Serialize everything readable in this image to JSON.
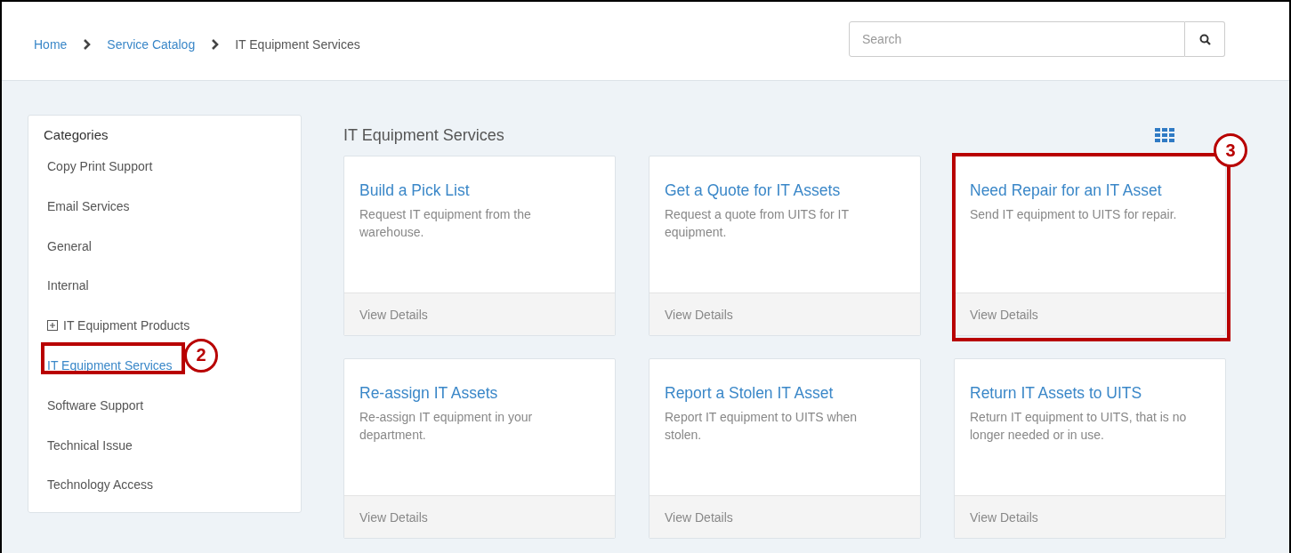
{
  "breadcrumb": [
    {
      "label": "Home",
      "link": true
    },
    {
      "label": "Service Catalog",
      "link": true
    },
    {
      "label": "IT Equipment Services",
      "link": false
    }
  ],
  "search": {
    "placeholder": "Search"
  },
  "sidebar": {
    "title": "Categories",
    "items": [
      {
        "label": "Copy Print Support",
        "selected": false
      },
      {
        "label": "Email Services",
        "selected": false
      },
      {
        "label": "General",
        "selected": false
      },
      {
        "label": "Internal",
        "selected": false
      },
      {
        "label": "IT Equipment Products",
        "selected": false,
        "expandable": true
      },
      {
        "label": "IT Equipment Services",
        "selected": true,
        "callout": "2"
      },
      {
        "label": "Software Support",
        "selected": false
      },
      {
        "label": "Technical Issue",
        "selected": false
      },
      {
        "label": "Technology Access",
        "selected": false
      }
    ]
  },
  "content": {
    "title": "IT Equipment Services",
    "cards": [
      {
        "title": "Build a Pick List",
        "description": "Request IT equipment from the warehouse.",
        "footer": "View Details"
      },
      {
        "title": "Get a Quote for IT Assets",
        "description": "Request a quote from UITS for IT equipment.",
        "footer": "View Details"
      },
      {
        "title": "Need Repair for an IT Asset",
        "description": "Send IT equipment to UITS for repair.",
        "footer": "View Details",
        "callout": "3"
      },
      {
        "title": "Re-assign IT Assets",
        "description": "Re-assign IT equipment in your department.",
        "footer": "View Details"
      },
      {
        "title": "Report a Stolen IT Asset",
        "description": "Report IT equipment to UITS when stolen.",
        "footer": "View Details"
      },
      {
        "title": "Return IT Assets to UITS",
        "description": "Return IT equipment to UITS, that is no longer needed or in use.",
        "footer": "View Details"
      }
    ]
  }
}
